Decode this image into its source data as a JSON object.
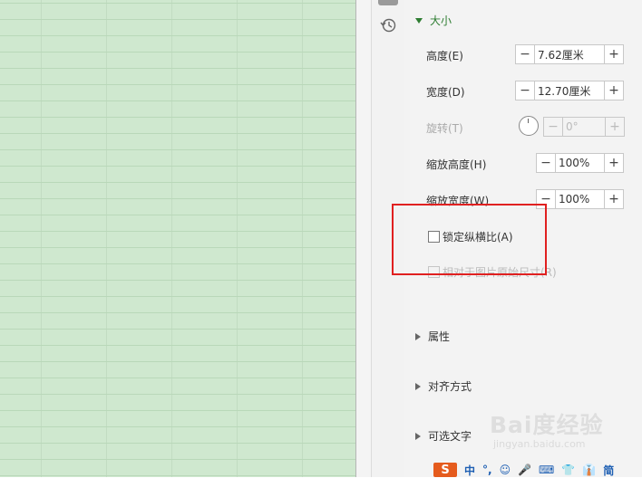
{
  "panel": {
    "size_section": {
      "title": "大小",
      "height": {
        "label": "高度(E)",
        "value": "7.62厘米"
      },
      "width": {
        "label": "宽度(D)",
        "value": "12.70厘米"
      },
      "rotate": {
        "label": "旋转(T)",
        "value": "0°"
      },
      "scale_height": {
        "label": "缩放高度(H)",
        "value": "100%"
      },
      "scale_width": {
        "label": "缩放宽度(W)",
        "value": "100%"
      },
      "lock_ratio": {
        "label": "锁定纵横比(A)",
        "checked": false
      },
      "relative_original": {
        "label": "相对于图片原始尺寸(R)",
        "checked": false
      }
    },
    "collapsed_sections": [
      "属性",
      "对齐方式",
      "可选文字"
    ]
  },
  "buttons": {
    "minus": "−",
    "plus": "+"
  },
  "icons": {
    "history": "history-icon",
    "expanded": "triangle-down-icon",
    "collapsed": "triangle-right-icon"
  },
  "watermark": {
    "text": "Bai度经验",
    "url": "jingyan.baidu.com"
  },
  "taskbar": {
    "ime_logo": "S",
    "items": [
      "中",
      "°,",
      "☺",
      "🎤",
      "⌨",
      "👕",
      "👔",
      "简"
    ]
  },
  "colors": {
    "sheet_bg": "#cfe8cf",
    "accent": "#2e7d32",
    "highlight": "#e02020"
  }
}
